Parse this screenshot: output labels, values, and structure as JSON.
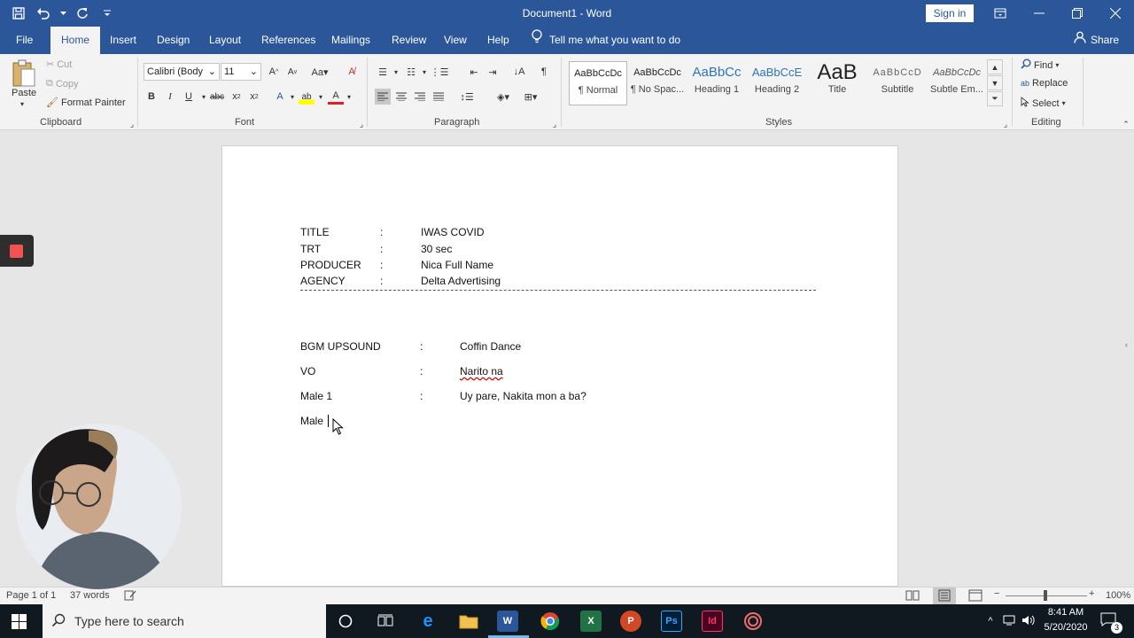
{
  "app": {
    "title": "Document1 - Word",
    "sign_in": "Sign in"
  },
  "tabs": [
    {
      "label": "File"
    },
    {
      "label": "Home"
    },
    {
      "label": "Insert"
    },
    {
      "label": "Design"
    },
    {
      "label": "Layout"
    },
    {
      "label": "References"
    },
    {
      "label": "Mailings"
    },
    {
      "label": "Review"
    },
    {
      "label": "View"
    },
    {
      "label": "Help"
    }
  ],
  "tell_me": "Tell me what you want to do",
  "share": "Share",
  "ribbon": {
    "clipboard": {
      "paste": "Paste",
      "cut": "Cut",
      "copy": "Copy",
      "format_painter": "Format Painter",
      "label": "Clipboard"
    },
    "font": {
      "font_name": "Calibri (Body",
      "font_size": "11",
      "label": "Font"
    },
    "paragraph": {
      "label": "Paragraph"
    },
    "styles": {
      "items": [
        {
          "preview": "AaBbCcDc",
          "name": "¶ Normal"
        },
        {
          "preview": "AaBbCcDc",
          "name": "¶ No Spac..."
        },
        {
          "preview": "AaBbCc",
          "name": "Heading 1"
        },
        {
          "preview": "AaBbCcE",
          "name": "Heading 2"
        },
        {
          "preview": "AaB",
          "name": "Title"
        },
        {
          "preview": "AaBbCcD",
          "name": "Subtitle"
        },
        {
          "preview": "AaBbCcDc",
          "name": "Subtle Em..."
        }
      ],
      "label": "Styles"
    },
    "editing": {
      "find": "Find",
      "replace": "Replace",
      "select": "Select",
      "label": "Editing"
    }
  },
  "document": {
    "header_rows": [
      {
        "key": "TITLE",
        "sep": ":",
        "value": "IWAS COVID"
      },
      {
        "key": "TRT",
        "sep": ":",
        "value": "30 sec"
      },
      {
        "key": "PRODUCER",
        "sep": ":",
        "value": "Nica Full Name"
      },
      {
        "key": "AGENCY",
        "sep": ":",
        "value": "Delta Advertising"
      }
    ],
    "script_rows": [
      {
        "key": "BGM UPSOUND",
        "sep": ":",
        "value": "Coffin Dance"
      },
      {
        "key": "VO",
        "sep": ":",
        "value": "Narito na"
      },
      {
        "key": "Male 1",
        "sep": ":",
        "value": "Uy pare, Nakita mon a ba?"
      }
    ],
    "typing_line": "Male"
  },
  "status": {
    "page": "Page 1 of 1",
    "words": "37 words",
    "zoom": "100%"
  },
  "taskbar": {
    "search_placeholder": "Type here to search",
    "time": "8:41 AM",
    "date": "5/20/2020",
    "notifications": "3"
  },
  "colors": {
    "word_blue": "#2b579a",
    "ribbon_bg": "#f3f3f3",
    "taskbar": "#101820",
    "spell_error": "#d00000",
    "recording": "#f25252"
  },
  "icons": [
    "save-icon",
    "undo-icon",
    "redo-icon",
    "lightbulb-icon",
    "person-icon",
    "search-icon",
    "windows-icon",
    "cortana-icon",
    "task-view-icon"
  ]
}
